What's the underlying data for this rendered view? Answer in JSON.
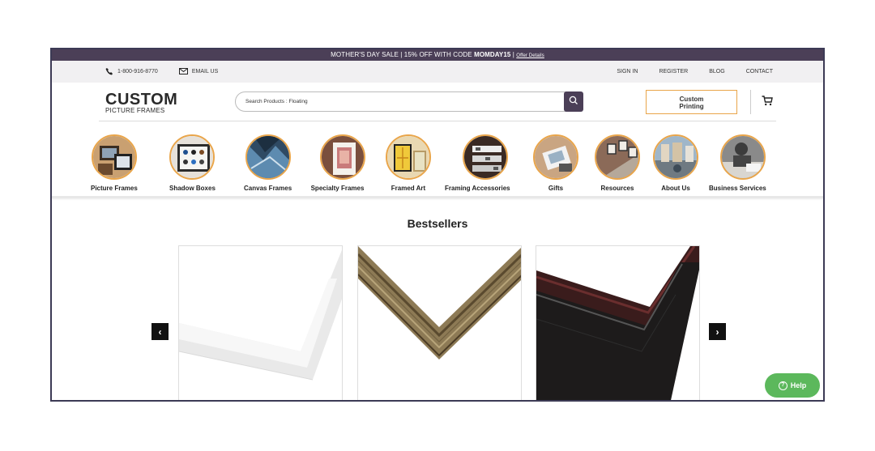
{
  "promo": {
    "prefix": "MOTHER'S DAY SALE | 15% OFF WITH CODE ",
    "code": "MOMDAY15",
    "separator": " | ",
    "link": "Offer Details"
  },
  "utility": {
    "phone": "1-800-916-8770",
    "email": "EMAIL US",
    "links": [
      "SIGN IN",
      "REGISTER",
      "BLOG",
      "CONTACT"
    ]
  },
  "logo": {
    "line1": "CUSTOM",
    "line2": "PICTURE FRAMES"
  },
  "search": {
    "value": "Search Products : Floating"
  },
  "custom_printing": {
    "line1": "Custom",
    "line2": "Printing"
  },
  "categories": [
    "Picture Frames",
    "Shadow Boxes",
    "Canvas Frames",
    "Specialty Frames",
    "Framed Art",
    "Framing Accessories",
    "Gifts",
    "Resources",
    "About Us",
    "Business Services"
  ],
  "bestsellers": {
    "title": "Bestsellers"
  },
  "carousel": {
    "prev": "‹",
    "next": "›"
  },
  "help": {
    "label": "Help"
  },
  "colors": {
    "brand": "#4b3f57",
    "accent": "#e9a54a",
    "help": "#5cb85c"
  }
}
